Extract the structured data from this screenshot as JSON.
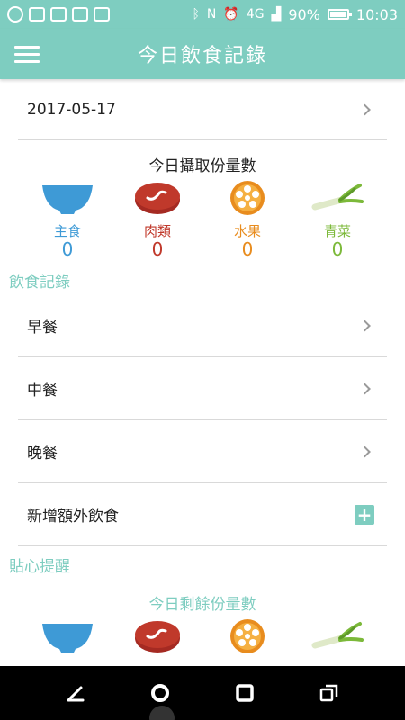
{
  "status_bar": {
    "battery": "90%",
    "battery_level": 0.9,
    "time": "10:03",
    "network": "4G"
  },
  "app_bar": {
    "title": "今日飲食記錄"
  },
  "date_row": {
    "value": "2017-05-17"
  },
  "intake": {
    "title": "今日攝取份量數",
    "items": [
      {
        "label": "主食",
        "count": "0",
        "icon": "bowl-icon",
        "color": "#3e9ad6"
      },
      {
        "label": "肉類",
        "count": "0",
        "icon": "meat-icon",
        "color": "#c0392b"
      },
      {
        "label": "水果",
        "count": "0",
        "icon": "fruit-icon",
        "color": "#e88c1e"
      },
      {
        "label": "青菜",
        "count": "0",
        "icon": "vegetable-icon",
        "color": "#7cb93a"
      }
    ]
  },
  "diet_record": {
    "header": "飲食記錄",
    "meals": [
      {
        "label": "早餐"
      },
      {
        "label": "中餐"
      },
      {
        "label": "晚餐"
      }
    ],
    "extra": {
      "label": "新增額外飲食"
    }
  },
  "reminder": {
    "header": "貼心提醒",
    "remaining_title": "今日剩餘份量數"
  },
  "colors": {
    "accent": "#7ecdc0",
    "nav_bar": "#000000"
  }
}
